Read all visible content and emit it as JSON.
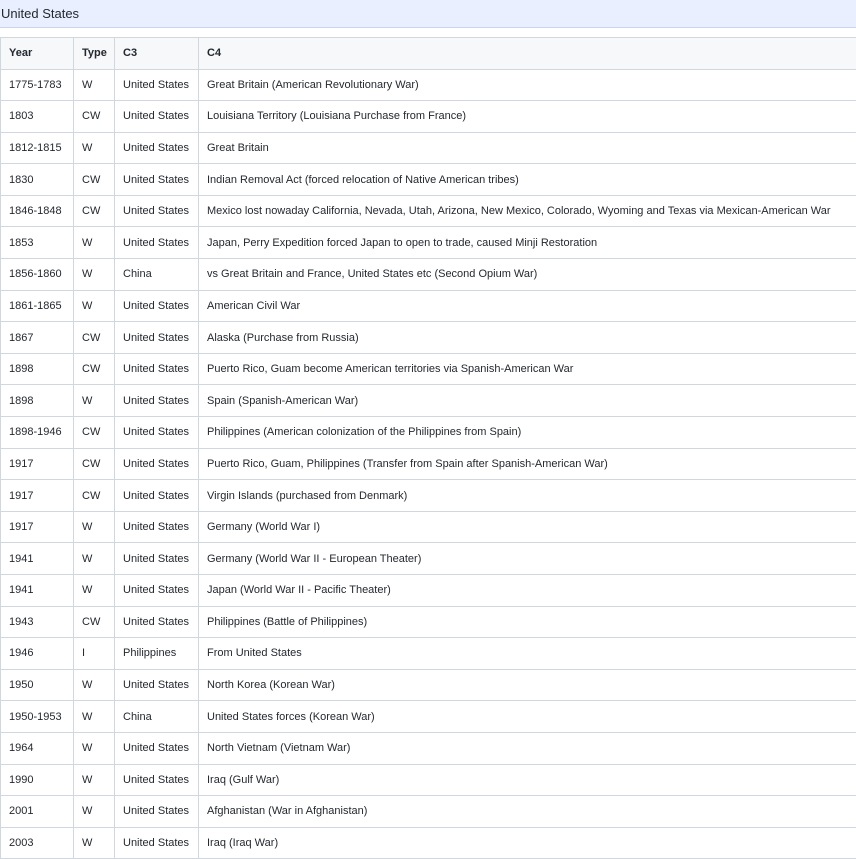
{
  "title": "United States",
  "columns": [
    "Year",
    "Type",
    "C3",
    "C4"
  ],
  "rows": [
    [
      "1775-1783",
      "W",
      "United States",
      "Great Britain (American Revolutionary War)"
    ],
    [
      "1803",
      "CW",
      "United States",
      "Louisiana Territory (Louisiana Purchase from France)"
    ],
    [
      "1812-1815",
      "W",
      "United States",
      "Great Britain"
    ],
    [
      "1830",
      "CW",
      "United States",
      "Indian Removal Act (forced relocation of Native American tribes)"
    ],
    [
      "1846-1848",
      "CW",
      "United States",
      "Mexico lost nowaday California, Nevada, Utah, Arizona, New Mexico, Colorado, Wyoming and Texas via Mexican-American War"
    ],
    [
      "1853",
      "W",
      "United States",
      "Japan, Perry Expedition forced Japan to open to trade, caused Minji Restoration"
    ],
    [
      "1856-1860",
      "W",
      "China",
      "vs Great Britain and France, United States etc (Second Opium War)"
    ],
    [
      "1861-1865",
      "W",
      "United States",
      "American Civil War"
    ],
    [
      "1867",
      "CW",
      "United States",
      "Alaska (Purchase from Russia)"
    ],
    [
      "1898",
      "CW",
      "United States",
      "Puerto Rico, Guam become American territories via Spanish-American War"
    ],
    [
      "1898",
      "W",
      "United States",
      "Spain (Spanish-American War)"
    ],
    [
      "1898-1946",
      "CW",
      "United States",
      "Philippines (American colonization of the Philippines from Spain)"
    ],
    [
      "1917",
      "CW",
      "United States",
      "Puerto Rico, Guam, Philippines (Transfer from Spain after Spanish-American War)"
    ],
    [
      "1917",
      "CW",
      "United States",
      "Virgin Islands (purchased from Denmark)"
    ],
    [
      "1917",
      "W",
      "United States",
      "Germany (World War I)"
    ],
    [
      "1941",
      "W",
      "United States",
      "Germany (World War II - European Theater)"
    ],
    [
      "1941",
      "W",
      "United States",
      "Japan (World War II - Pacific Theater)"
    ],
    [
      "1943",
      "CW",
      "United States",
      "Philippines (Battle of Philippines)"
    ],
    [
      "1946",
      "I",
      "Philippines",
      "From United States"
    ],
    [
      "1950",
      "W",
      "United States",
      "North Korea (Korean War)"
    ],
    [
      "1950-1953",
      "W",
      "China",
      "United States forces (Korean War)"
    ],
    [
      "1964",
      "W",
      "United States",
      "North Vietnam (Vietnam War)"
    ],
    [
      "1990",
      "W",
      "United States",
      "Iraq (Gulf War)"
    ],
    [
      "2001",
      "W",
      "United States",
      "Afghanistan (War in Afghanistan)"
    ],
    [
      "2003",
      "W",
      "United States",
      "Iraq (Iraq War)"
    ]
  ]
}
